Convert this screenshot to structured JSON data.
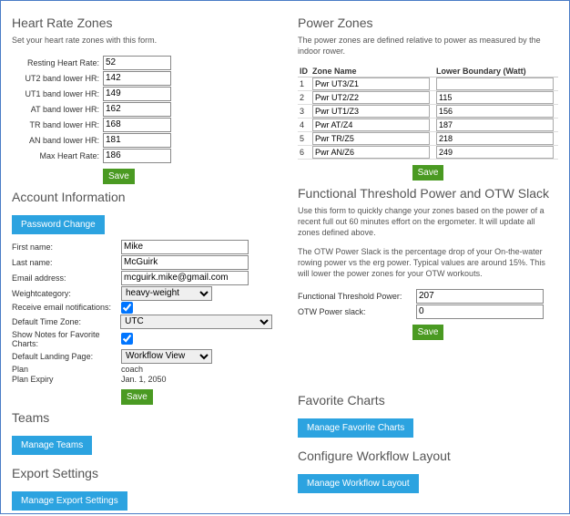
{
  "hr": {
    "title": "Heart Rate Zones",
    "desc": "Set your heart rate zones with this form.",
    "rows": [
      {
        "label": "Resting Heart Rate:",
        "value": "52"
      },
      {
        "label": "UT2 band lower HR:",
        "value": "142"
      },
      {
        "label": "UT1 band lower HR:",
        "value": "149"
      },
      {
        "label": "AT band lower HR:",
        "value": "162"
      },
      {
        "label": "TR band lower HR:",
        "value": "168"
      },
      {
        "label": "AN band lower HR:",
        "value": "181"
      },
      {
        "label": "Max Heart Rate:",
        "value": "186"
      }
    ],
    "save": "Save"
  },
  "pz": {
    "title": "Power Zones",
    "desc": "The power zones are defined relative to power as measured by the indoor rower.",
    "head_id": "ID",
    "head_name": "Zone Name",
    "head_lb": "Lower Boundary (Watt)",
    "rows": [
      {
        "id": "1",
        "name": "Pwr UT3/Z1",
        "lb": ""
      },
      {
        "id": "2",
        "name": "Pwr UT2/Z2",
        "lb": "115"
      },
      {
        "id": "3",
        "name": "Pwr UT1/Z3",
        "lb": "156"
      },
      {
        "id": "4",
        "name": "Pwr AT/Z4",
        "lb": "187"
      },
      {
        "id": "5",
        "name": "Pwr TR/Z5",
        "lb": "218"
      },
      {
        "id": "6",
        "name": "Pwr AN/Z6",
        "lb": "249"
      }
    ],
    "save": "Save"
  },
  "acc": {
    "title": "Account Information",
    "password_change": "Password Change",
    "first_name_label": "First name:",
    "first_name": "Mike",
    "last_name_label": "Last name:",
    "last_name": "McGuirk",
    "email_label": "Email address:",
    "email": "mcguirk.mike@gmail.com",
    "weightcat_label": "Weightcategory:",
    "weightcat": "heavy-weight",
    "recv_email_label": "Receive email notifications:",
    "tz_label": "Default Time Zone:",
    "tz": "UTC",
    "notes_fav_label": "Show Notes for Favorite Charts:",
    "landing_label": "Default Landing Page:",
    "landing": "Workflow View",
    "plan_label": "Plan",
    "plan": "coach",
    "plan_exp_label": "Plan Expiry",
    "plan_exp": "Jan. 1, 2050",
    "save": "Save"
  },
  "ftp": {
    "title": "Functional Threshold Power and OTW Slack",
    "desc1": "Use this form to quickly change your zones based on the power of a recent full out 60 minutes effort on the ergometer. It will update all zones defined above.",
    "desc2": "The OTW Power Slack is the percentage drop of your On-the-water rowing power vs the erg power. Typical values are around 15%. This will lower the power zones for your OTW workouts.",
    "ftp_label": "Functional Threshold Power:",
    "ftp_val": "207",
    "slack_label": "OTW Power slack:",
    "slack_val": "0",
    "save": "Save"
  },
  "teams": {
    "title": "Teams",
    "btn": "Manage Teams"
  },
  "fav": {
    "title": "Favorite Charts",
    "btn": "Manage Favorite Charts"
  },
  "export": {
    "title": "Export Settings",
    "btn": "Manage Export Settings"
  },
  "workflow": {
    "title": "Configure Workflow Layout",
    "btn": "Manage Workflow Layout"
  }
}
